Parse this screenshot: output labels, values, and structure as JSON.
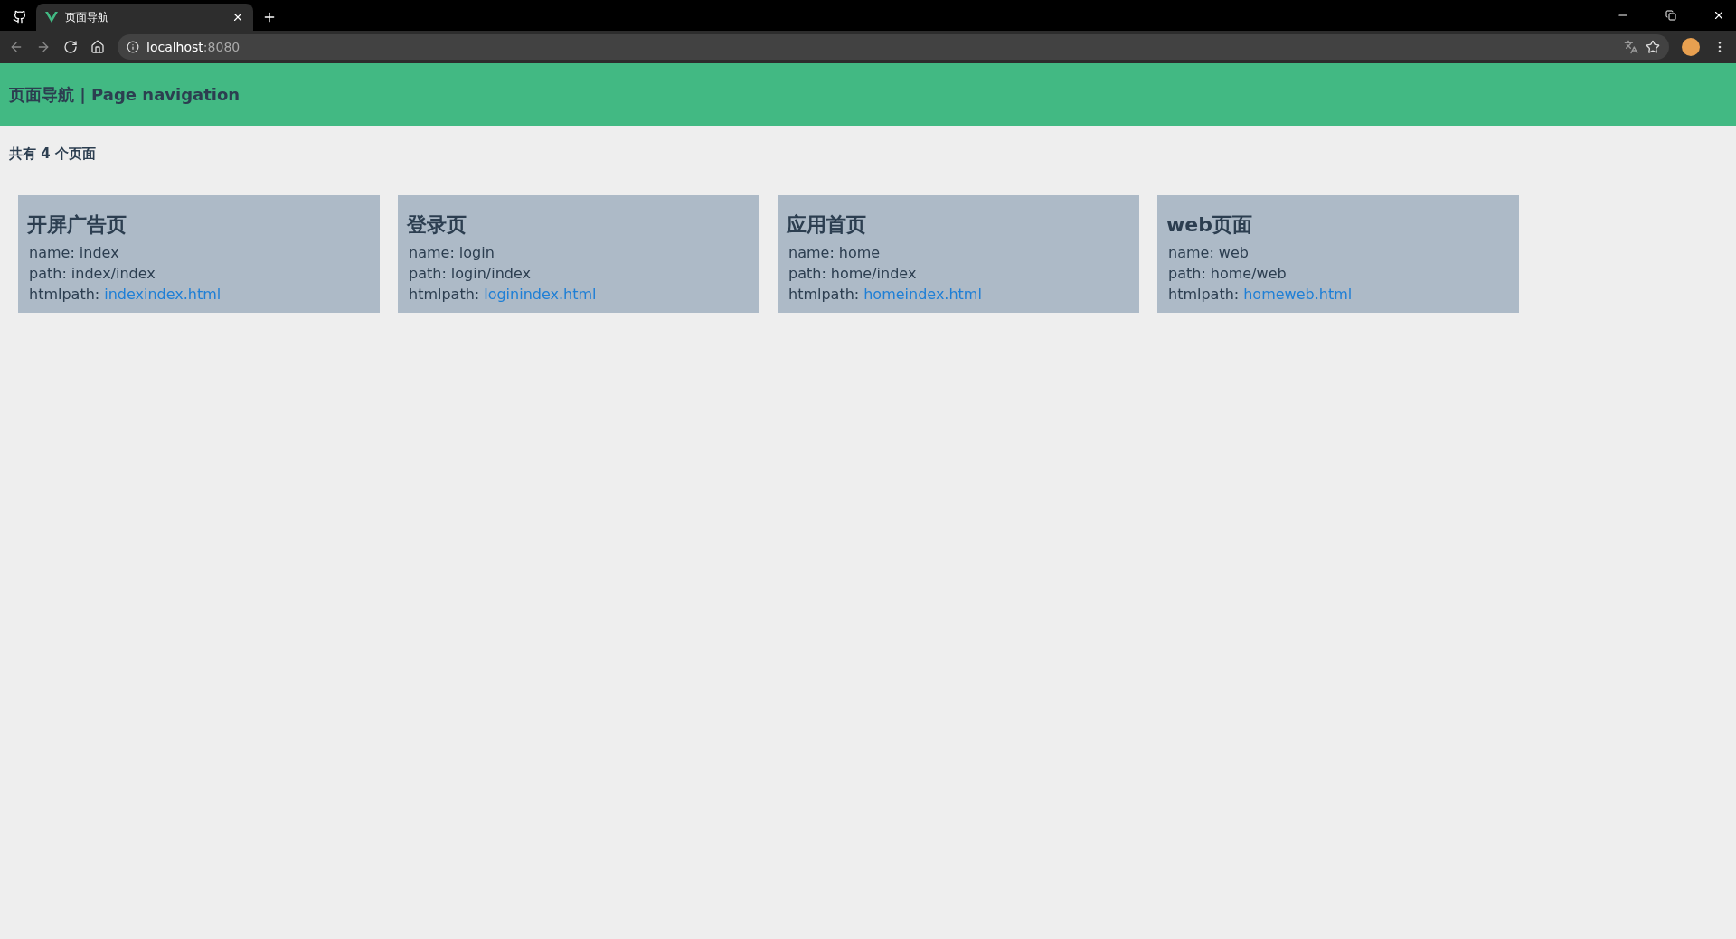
{
  "browser": {
    "tabs": [
      {
        "title": "页面导航",
        "selected": true
      }
    ],
    "address": {
      "host": "localhost",
      "port": ":8080"
    }
  },
  "header": {
    "title": "页面导航 | Page navigation"
  },
  "summary": "共有 4 个页面",
  "cards": [
    {
      "title": "开屏广告页",
      "name": "name: index",
      "path": "path: index/index",
      "htmlpath_label": "htmlpath:",
      "htmlpath_link": "indexindex.html"
    },
    {
      "title": "登录页",
      "name": "name: login",
      "path": "path: login/index",
      "htmlpath_label": "htmlpath:",
      "htmlpath_link": "loginindex.html"
    },
    {
      "title": "应用首页",
      "name": "name: home",
      "path": "path: home/index",
      "htmlpath_label": "htmlpath:",
      "htmlpath_link": "homeindex.html"
    },
    {
      "title": "web页面",
      "name": "name: web",
      "path": "path: home/web",
      "htmlpath_label": "htmlpath:",
      "htmlpath_link": "homeweb.html"
    }
  ]
}
